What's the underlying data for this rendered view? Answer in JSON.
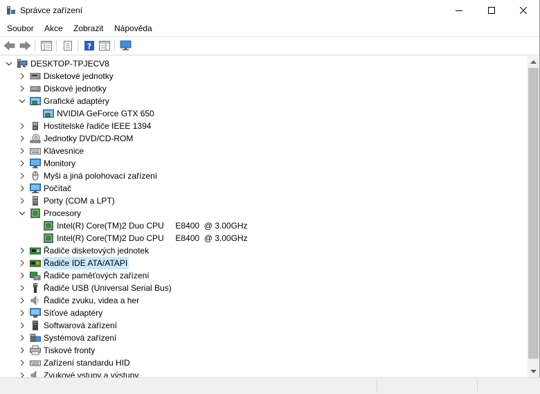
{
  "window": {
    "title": "Správce zařízení"
  },
  "menu": [
    {
      "label": "Soubor"
    },
    {
      "label": "Akce"
    },
    {
      "label": "Zobrazit"
    },
    {
      "label": "Nápověda"
    }
  ],
  "tree": {
    "root": "DESKTOP-TPJECV8",
    "items": [
      {
        "label": "Disketové jednotky",
        "icon": "floppy-drive-icon"
      },
      {
        "label": "Diskové jednotky",
        "icon": "disk-drive-icon"
      },
      {
        "label": "Grafické adaptéry",
        "icon": "display-adapter-icon",
        "expanded": true,
        "children": [
          {
            "label": "NVIDIA GeForce GTX 650",
            "icon": "display-adapter-icon"
          }
        ]
      },
      {
        "label": "Hostitelské řadiče IEEE 1394",
        "icon": "ieee1394-icon"
      },
      {
        "label": "Jednotky DVD/CD-ROM",
        "icon": "dvd-drive-icon"
      },
      {
        "label": "Klávesnice",
        "icon": "keyboard-icon"
      },
      {
        "label": "Monitory",
        "icon": "monitor-icon"
      },
      {
        "label": "Myši a jiná polohovací zařízení",
        "icon": "mouse-icon"
      },
      {
        "label": "Počítač",
        "icon": "computer-icon"
      },
      {
        "label": "Porty (COM a LPT)",
        "icon": "port-icon"
      },
      {
        "label": "Procesory",
        "icon": "processor-icon",
        "expanded": true,
        "children": [
          {
            "label": "Intel(R) Core(TM)2 Duo CPU     E8400  @ 3.00GHz",
            "icon": "processor-icon"
          },
          {
            "label": "Intel(R) Core(TM)2 Duo CPU     E8400  @ 3.00GHz",
            "icon": "processor-icon"
          }
        ]
      },
      {
        "label": "Řadiče disketových jednotek",
        "icon": "floppy-controller-icon"
      },
      {
        "label": "Řadiče IDE ATA/ATAPI",
        "icon": "ide-controller-icon",
        "selected": true
      },
      {
        "label": "Řadiče paměťových zařízení",
        "icon": "storage-controller-icon"
      },
      {
        "label": "Řadiče USB (Universal Serial Bus)",
        "icon": "usb-icon"
      },
      {
        "label": "Řadiče zvuku, videa a her",
        "icon": "sound-icon"
      },
      {
        "label": "Síťové adaptéry",
        "icon": "network-adapter-icon"
      },
      {
        "label": "Softwarová zařízení",
        "icon": "software-device-icon"
      },
      {
        "label": "Systémová zařízení",
        "icon": "system-device-icon"
      },
      {
        "label": "Tiskové fronty",
        "icon": "printer-icon"
      },
      {
        "label": "Zařízení standardu HID",
        "icon": "hid-icon"
      },
      {
        "label": "Zvukové vstupy a výstupy",
        "icon": "audio-io-icon"
      }
    ]
  },
  "colors": {
    "selection": "#cce8ff",
    "scroll_thumb": "#c2c2c2"
  }
}
